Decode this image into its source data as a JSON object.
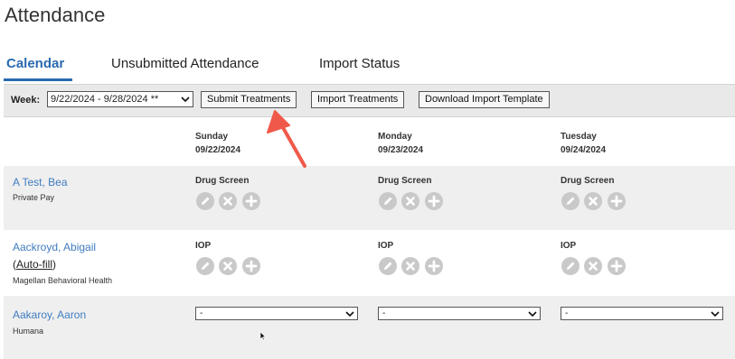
{
  "page": {
    "title": "Attendance"
  },
  "tabs": [
    {
      "label": "Calendar",
      "active": true
    },
    {
      "label": "Unsubmitted Attendance",
      "active": false
    },
    {
      "label": "Import Status",
      "active": false
    }
  ],
  "toolbar": {
    "week_label": "Week:",
    "week_value": "9/22/2024 - 9/28/2024 **",
    "submit_label": "Submit Treatments",
    "import_label": "Import Treatments",
    "download_label": "Download Import Template"
  },
  "days": [
    {
      "name": "Sunday",
      "date": "09/22/2024"
    },
    {
      "name": "Monday",
      "date": "09/23/2024"
    },
    {
      "name": "Tuesday",
      "date": "09/24/2024"
    }
  ],
  "patients": [
    {
      "name": "A Test, Bea",
      "payer": "Private Pay",
      "service": "Drug Screen"
    },
    {
      "name": "Aackroyd, Abigail",
      "autofill_open": "(",
      "autofill_link": "Auto-fill",
      "autofill_close": ")",
      "payer": "Magellan Behavioral Health",
      "service": "IOP"
    },
    {
      "name": "Aakaroy, Aaron",
      "payer": "Humana",
      "dropdown_value": "-"
    }
  ],
  "colors": {
    "accent": "#2a6ab0",
    "link": "#3f7cc0",
    "annotation_arrow": "#f0594a",
    "row_shade": "#efefef",
    "icon_bg": "#c9c9c9"
  },
  "icons": [
    "edit-icon",
    "delete-icon",
    "add-icon",
    "chevron-down-icon",
    "mouse-cursor-icon"
  ]
}
